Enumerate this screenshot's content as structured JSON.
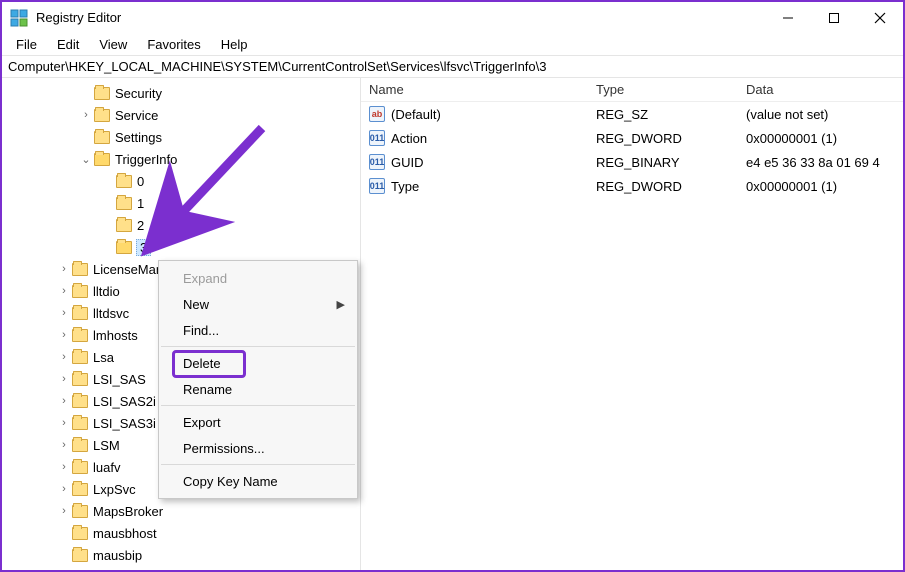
{
  "window": {
    "title": "Registry Editor"
  },
  "menu": {
    "file": "File",
    "edit": "Edit",
    "view": "View",
    "favorites": "Favorites",
    "help": "Help"
  },
  "address": "Computer\\HKEY_LOCAL_MACHINE\\SYSTEM\\CurrentControlSet\\Services\\lfsvc\\TriggerInfo\\3",
  "tree": {
    "items": [
      {
        "indent": 78,
        "exp": "",
        "label": "Security"
      },
      {
        "indent": 78,
        "exp": ">",
        "label": "Service"
      },
      {
        "indent": 78,
        "exp": "",
        "label": "Settings"
      },
      {
        "indent": 78,
        "exp": "v",
        "label": "TriggerInfo",
        "open": true
      },
      {
        "indent": 100,
        "exp": "",
        "label": "0"
      },
      {
        "indent": 100,
        "exp": "",
        "label": "1"
      },
      {
        "indent": 100,
        "exp": "",
        "label": "2"
      },
      {
        "indent": 100,
        "exp": "",
        "label": "3",
        "open": true,
        "selected": true
      },
      {
        "indent": 56,
        "exp": ">",
        "label": "LicenseManager"
      },
      {
        "indent": 56,
        "exp": ">",
        "label": "lltdio"
      },
      {
        "indent": 56,
        "exp": ">",
        "label": "lltdsvc"
      },
      {
        "indent": 56,
        "exp": ">",
        "label": "lmhosts"
      },
      {
        "indent": 56,
        "exp": ">",
        "label": "Lsa"
      },
      {
        "indent": 56,
        "exp": ">",
        "label": "LSI_SAS"
      },
      {
        "indent": 56,
        "exp": ">",
        "label": "LSI_SAS2i"
      },
      {
        "indent": 56,
        "exp": ">",
        "label": "LSI_SAS3i"
      },
      {
        "indent": 56,
        "exp": ">",
        "label": "LSM"
      },
      {
        "indent": 56,
        "exp": ">",
        "label": "luafv"
      },
      {
        "indent": 56,
        "exp": ">",
        "label": "LxpSvc"
      },
      {
        "indent": 56,
        "exp": ">",
        "label": "MapsBroker"
      },
      {
        "indent": 56,
        "exp": "",
        "label": "mausbhost"
      },
      {
        "indent": 56,
        "exp": "",
        "label": "mausbip"
      }
    ]
  },
  "columns": {
    "name": "Name",
    "type": "Type",
    "data": "Data"
  },
  "values": [
    {
      "icon": "str",
      "name": "(Default)",
      "type": "REG_SZ",
      "data": "(value not set)"
    },
    {
      "icon": "bin",
      "name": "Action",
      "type": "REG_DWORD",
      "data": "0x00000001 (1)"
    },
    {
      "icon": "bin",
      "name": "GUID",
      "type": "REG_BINARY",
      "data": "e4 e5 36 33 8a 01 69 4"
    },
    {
      "icon": "bin",
      "name": "Type",
      "type": "REG_DWORD",
      "data": "0x00000001 (1)"
    }
  ],
  "context_menu": {
    "expand": "Expand",
    "new": "New",
    "find": "Find...",
    "delete": "Delete",
    "rename": "Rename",
    "export": "Export",
    "permissions": "Permissions...",
    "copykey": "Copy Key Name"
  },
  "icon_glyphs": {
    "str": "ab",
    "bin": "011"
  }
}
